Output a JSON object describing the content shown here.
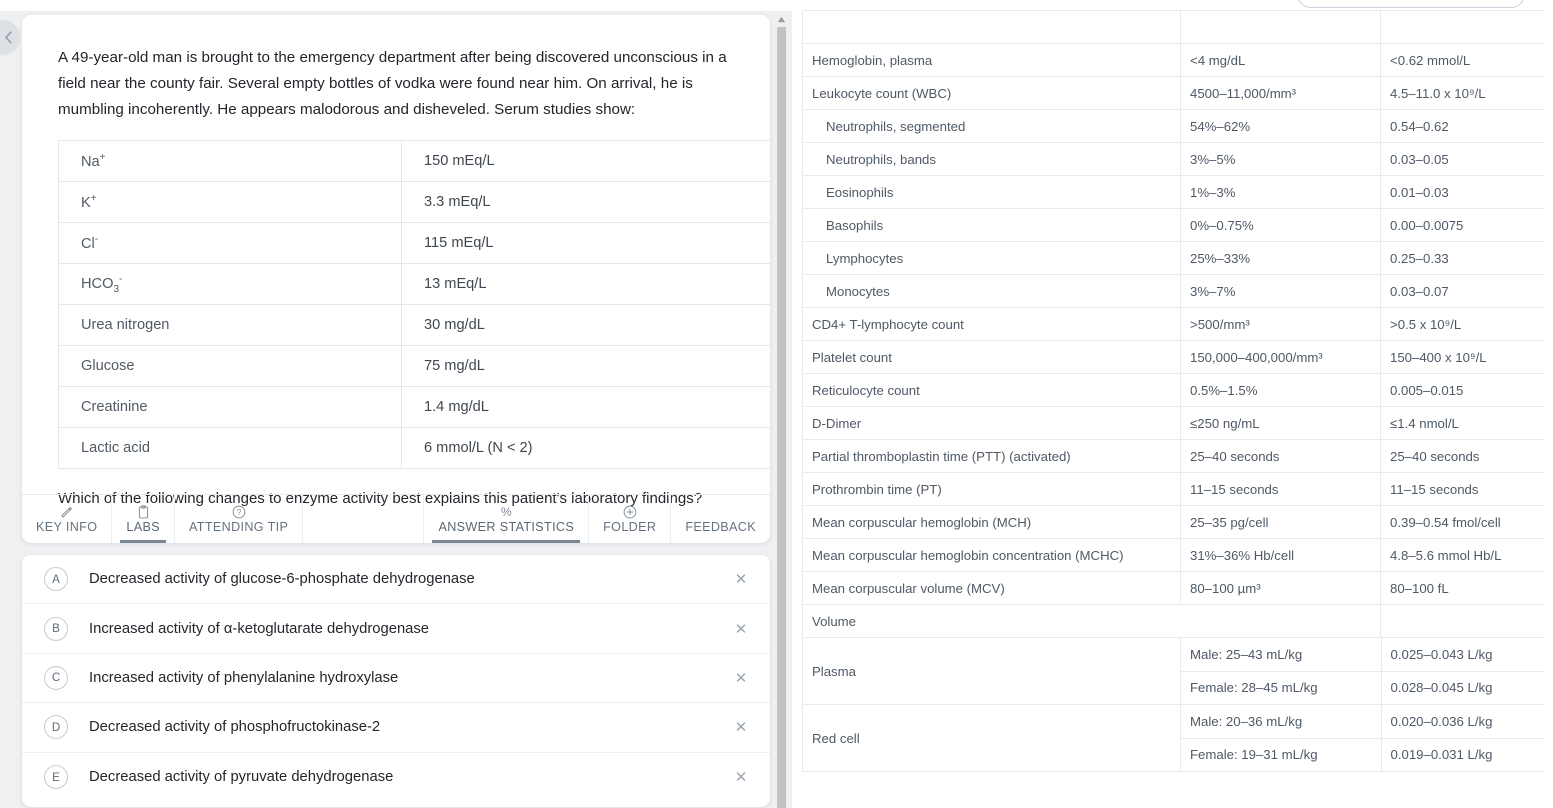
{
  "left": {
    "collapse_icon": "chevron-left-icon",
    "stem": "A 49-year-old man is brought to the emergency department after being discovered unconscious in a field near the county fair. Several empty bottles of vodka were found near him. On arrival, he is mumbling incoherently. He appears malodorous and disheveled. Serum studies show:",
    "lead_in": "Which of the following changes to enzyme activity best explains this patient's laboratory findings?",
    "serum_studies": [
      {
        "label": "Na",
        "sup": "+",
        "sub": "",
        "value": "150 mEq/L"
      },
      {
        "label": "K",
        "sup": "+",
        "sub": "",
        "value": "3.3 mEq/L"
      },
      {
        "label": "Cl",
        "sup": "-",
        "sub": "",
        "value": "115 mEq/L"
      },
      {
        "label": "HCO",
        "sup": "-",
        "sub": "3",
        "value": "13 mEq/L"
      },
      {
        "label": "Urea nitrogen",
        "sup": "",
        "sub": "",
        "value": "30 mg/dL"
      },
      {
        "label": "Glucose",
        "sup": "",
        "sub": "",
        "value": "75 mg/dL"
      },
      {
        "label": "Creatinine",
        "sup": "",
        "sub": "",
        "value": "1.4 mg/dL"
      },
      {
        "label": "Lactic acid",
        "sup": "",
        "sub": "",
        "value": "6 mmol/L (N < 2)"
      }
    ],
    "tabs": [
      {
        "label": "KEY INFO",
        "icon": "pencil-icon",
        "active": false
      },
      {
        "label": "LABS",
        "icon": "clipboard-icon",
        "active": true
      },
      {
        "label": "ATTENDING TIP",
        "icon": "question-circle-icon",
        "active": false
      },
      {
        "label": "ANSWER STATISTICS",
        "icon": "percent-icon",
        "active": true
      },
      {
        "label": "FOLDER",
        "icon": "plus-circle-icon",
        "active": false
      },
      {
        "label": "FEEDBACK",
        "icon": "",
        "active": false
      }
    ],
    "options": [
      {
        "letter": "A",
        "text": "Decreased activity of glucose-6-phosphate dehydrogenase",
        "strike": "✕"
      },
      {
        "letter": "B",
        "text": "Increased activity of α-ketoglutarate dehydrogenase",
        "strike": "✕"
      },
      {
        "letter": "C",
        "text": "Increased activity of phenylalanine hydroxylase",
        "strike": "✕"
      },
      {
        "letter": "D",
        "text": "Decreased activity of phosphofructokinase-2",
        "strike": "✕"
      },
      {
        "letter": "E",
        "text": "Decreased activity of pyruvate dehydrogenase",
        "strike": "✕"
      }
    ],
    "scrollbar": {
      "up_arrow": "scroll-up-arrow-icon"
    }
  },
  "right": {
    "search_placeholder": "",
    "search_value": "",
    "lab_rows": [
      {
        "name": "Hemoglobin, plasma",
        "indent": false,
        "conventional": "<4 mg/dL",
        "si": "<0.62 mmol/L"
      },
      {
        "name": "Leukocyte count (WBC)",
        "indent": false,
        "conventional": "4500–11,000/mm³",
        "si": "4.5–11.0 x 10⁹/L"
      },
      {
        "name": "Neutrophils, segmented",
        "indent": true,
        "conventional": "54%–62%",
        "si": "0.54–0.62"
      },
      {
        "name": "Neutrophils, bands",
        "indent": true,
        "conventional": "3%–5%",
        "si": "0.03–0.05"
      },
      {
        "name": "Eosinophils",
        "indent": true,
        "conventional": "1%–3%",
        "si": "0.01–0.03"
      },
      {
        "name": "Basophils",
        "indent": true,
        "conventional": "0%–0.75%",
        "si": "0.00–0.0075"
      },
      {
        "name": "Lymphocytes",
        "indent": true,
        "conventional": "25%–33%",
        "si": "0.25–0.33"
      },
      {
        "name": "Monocytes",
        "indent": true,
        "conventional": "3%–7%",
        "si": "0.03–0.07"
      },
      {
        "name": "CD4+ T-lymphocyte count",
        "indent": false,
        "conventional": ">500/mm³",
        "si": ">0.5 x 10⁹/L"
      },
      {
        "name": "Platelet count",
        "indent": false,
        "conventional": "150,000–400,000/mm³",
        "si": "150–400 x 10⁹/L"
      },
      {
        "name": "Reticulocyte count",
        "indent": false,
        "conventional": "0.5%–1.5%",
        "si": "0.005–0.015"
      },
      {
        "name": "D-Dimer",
        "indent": false,
        "conventional": "≤250 ng/mL",
        "si": "≤1.4 nmol/L"
      },
      {
        "name": "Partial thromboplastin time (PTT) (activated)",
        "indent": false,
        "conventional": "25–40 seconds",
        "si": "25–40 seconds"
      },
      {
        "name": "Prothrombin time (PT)",
        "indent": false,
        "conventional": "11–15 seconds",
        "si": "11–15 seconds"
      },
      {
        "name": "Mean corpuscular hemoglobin (MCH)",
        "indent": false,
        "conventional": "25–35 pg/cell",
        "si": "0.39–0.54 fmol/cell"
      },
      {
        "name": "Mean corpuscular hemoglobin concentration (MCHC)",
        "indent": false,
        "conventional": "31%–36% Hb/cell",
        "si": "4.8–5.6 mmol Hb/L"
      },
      {
        "name": "Mean corpuscular volume (MCV)",
        "indent": false,
        "conventional": "80–100 µm³",
        "si": "80–100 fL"
      }
    ],
    "volume_header": "Volume",
    "volume_groups": [
      {
        "name": "Plasma",
        "rows": [
          {
            "conventional": "Male: 25–43 mL/kg",
            "si": "0.025–0.043 L/kg"
          },
          {
            "conventional": "Female: 28–45 mL/kg",
            "si": "0.028–0.045 L/kg"
          }
        ]
      },
      {
        "name": "Red cell",
        "rows": [
          {
            "conventional": "Male: 20–36 mL/kg",
            "si": "0.020–0.036 L/kg"
          },
          {
            "conventional": "Female: 19–31 mL/kg",
            "si": "0.019–0.031 L/kg"
          }
        ]
      }
    ]
  },
  "colors": {
    "page_bg": "#eef0f2",
    "card_bg": "#ffffff",
    "text": "#22262b",
    "muted_text": "#4e5966",
    "border": "#e7eaee",
    "accent": "#7b8794"
  }
}
